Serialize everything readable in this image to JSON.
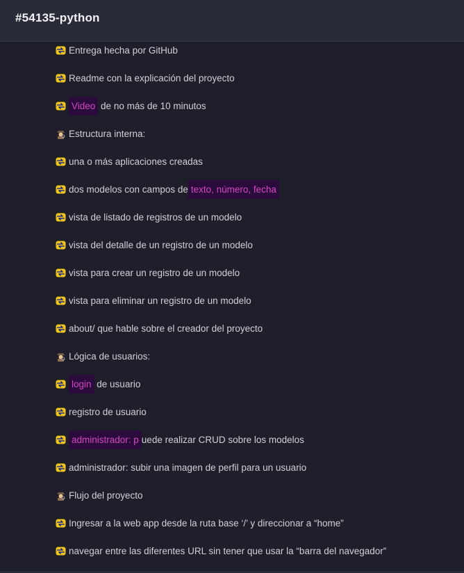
{
  "header": {
    "channel_title": "#54135-python"
  },
  "lines": [
    {
      "icon": "arrow-cycle-icon",
      "pre": "Entrega hecha por GitHub",
      "hl": "",
      "post": ""
    },
    {
      "icon": "arrow-cycle-icon",
      "pre": "Readme con la explicación del proyecto",
      "hl": "",
      "post": ""
    },
    {
      "icon": "arrow-cycle-icon",
      "pre": "",
      "hl": "Video",
      "post": " de no más de 10 minutos"
    },
    {
      "icon": "detective-icon",
      "pre": "Estructura interna:",
      "hl": "",
      "post": ""
    },
    {
      "icon": "arrow-cycle-icon",
      "pre": "una o más aplicaciones creadas",
      "hl": "",
      "post": ""
    },
    {
      "icon": "arrow-cycle-icon",
      "pre": "dos modelos con campos de",
      "hl": "texto, número, fecha",
      "post": ""
    },
    {
      "icon": "arrow-cycle-icon",
      "pre": "vista de listado de registros de un modelo",
      "hl": "",
      "post": ""
    },
    {
      "icon": "arrow-cycle-icon",
      "pre": "vista del detalle de un registro de un modelo",
      "hl": "",
      "post": ""
    },
    {
      "icon": "arrow-cycle-icon",
      "pre": "vista para crear un registro de un modelo",
      "hl": "",
      "post": ""
    },
    {
      "icon": "arrow-cycle-icon",
      "pre": "vista para eliminar un registro de un modelo",
      "hl": "",
      "post": ""
    },
    {
      "icon": "arrow-cycle-icon",
      "pre": "about/ que hable sobre el creador del proyecto",
      "hl": "",
      "post": ""
    },
    {
      "icon": "detective-icon",
      "pre": "Lógica de usuarios:",
      "hl": "",
      "post": ""
    },
    {
      "icon": "arrow-cycle-icon",
      "pre": "",
      "hl": "login",
      "post": " de usuario"
    },
    {
      "icon": "arrow-cycle-icon",
      "pre": "registro de usuario",
      "hl": "",
      "post": ""
    },
    {
      "icon": "arrow-cycle-icon",
      "pre": "",
      "hl": "administrador: p",
      "post": "uede realizar CRUD sobre los modelos"
    },
    {
      "icon": "arrow-cycle-icon",
      "pre": "administrador: subir una imagen de perfil para un usuario",
      "hl": "",
      "post": ""
    },
    {
      "icon": "detective-icon",
      "pre": "Flujo del proyecto",
      "hl": "",
      "post": ""
    },
    {
      "icon": "arrow-cycle-icon",
      "pre": "Ingresar a la web app desde la ruta base ‘/’ y direccionar a “home”",
      "hl": "",
      "post": ""
    },
    {
      "icon": "arrow-cycle-icon",
      "pre": "navegar entre las diferentes URL sin tener que usar la “barra del navegador”",
      "hl": "",
      "post": ""
    }
  ],
  "colors": {
    "background": "#1e1f2b",
    "header": "#2a2b38",
    "highlight_bg": "#2a0b3b",
    "highlight_text": "#d447c2"
  }
}
